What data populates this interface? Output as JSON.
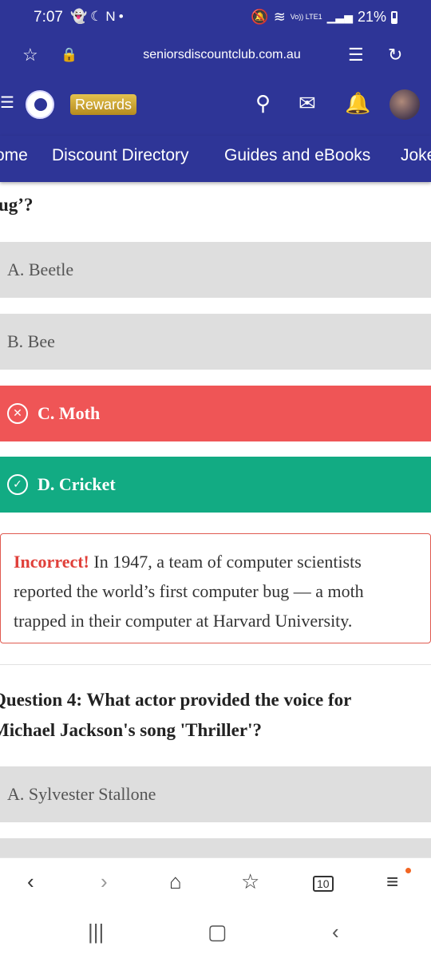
{
  "status": {
    "time": "7:07",
    "left_icons": [
      "snapchat-icon",
      "moon-icon",
      "n-icon",
      "dot-icon"
    ],
    "volte": "Vo)) LTE1",
    "battery": "21%"
  },
  "browser": {
    "url": "seniorsdiscountclub.com.au"
  },
  "site": {
    "rewards_label": "Rewards",
    "menu": [
      "ome",
      "Discount Directory",
      "Guides and eBooks",
      "Joke"
    ]
  },
  "quiz": {
    "q3_tail": "ug’?",
    "q3_options": [
      "A. Beetle",
      "B. Bee",
      "C. Moth",
      "D. Cricket"
    ],
    "feedback_label": "Incorrect!",
    "feedback_lines": [
      "In 1947, a team of computer scientists",
      "reported the world’s first computer bug — a moth",
      "trapped in their computer at Harvard University."
    ],
    "q4_lines": [
      "Question 4: What actor provided the voice for",
      "Michael Jackson's song 'Thriller'?"
    ],
    "q4_options": [
      "A. Sylvester Stallone"
    ]
  },
  "bottom_bar": {
    "tab_count": "10"
  },
  "colors": {
    "brand": "#2e3597",
    "wrong": "#ef5556",
    "right": "#12ab83",
    "option": "#dedede",
    "rewards": "#c9a233"
  }
}
